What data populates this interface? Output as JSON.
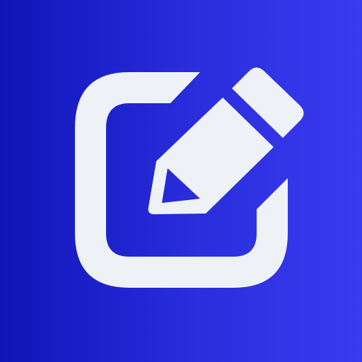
{
  "app_icon": {
    "name": "edit-icon",
    "background_gradient": [
      "#0f14b8",
      "#2a2edd",
      "#3a3af0"
    ],
    "glyph_color": "#eef2f7"
  }
}
